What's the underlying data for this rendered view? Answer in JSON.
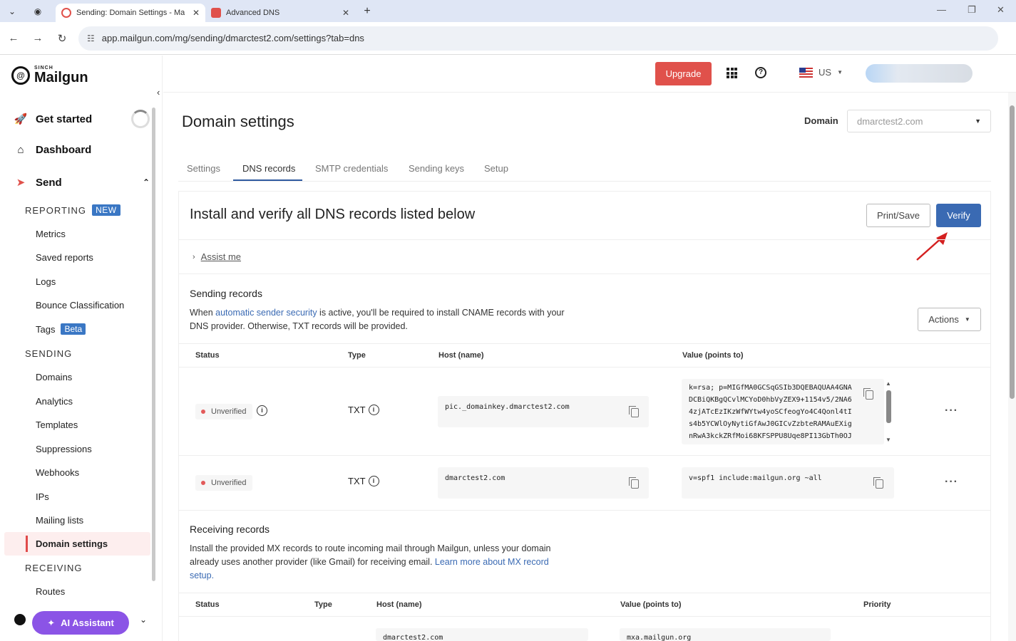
{
  "browser": {
    "tabs": [
      {
        "title": "Sending: Domain Settings - Ma",
        "active": true
      },
      {
        "title": "Advanced DNS",
        "active": false
      }
    ],
    "new_tab": "+",
    "url": "app.mailgun.com/mg/sending/dmarctest2.com/settings?tab=dns"
  },
  "brand": {
    "sinch": "SINCH",
    "name": "Mailgun"
  },
  "sidebar": {
    "get_started": "Get started",
    "dashboard": "Dashboard",
    "send": "Send",
    "reporting": {
      "label": "REPORTING",
      "badge": "NEW"
    },
    "reporting_items": [
      "Metrics",
      "Saved reports",
      "Logs",
      "Bounce Classification",
      "Tags"
    ],
    "tags_badge": "Beta",
    "sending": {
      "label": "SENDING"
    },
    "sending_items": [
      "Domains",
      "Analytics",
      "Templates",
      "Suppressions",
      "Webhooks",
      "IPs",
      "Mailing lists",
      "Domain settings"
    ],
    "receiving": {
      "label": "RECEIVING"
    },
    "receiving_items": [
      "Routes"
    ],
    "ai_assistant": "AI Assistant"
  },
  "header": {
    "upgrade": "Upgrade",
    "region": "US"
  },
  "page": {
    "title": "Domain settings",
    "domain_label": "Domain",
    "domain_value": "dmarctest2.com",
    "tabs": [
      "Settings",
      "DNS records",
      "SMTP credentials",
      "Sending keys",
      "Setup"
    ],
    "active_tab": "DNS records"
  },
  "card": {
    "heading": "Install and verify all DNS records listed below",
    "print_save": "Print/Save",
    "verify": "Verify",
    "assist_me": "Assist me"
  },
  "sending_records": {
    "title": "Sending records",
    "desc_pre": "When ",
    "desc_link": "automatic sender security",
    "desc_post": " is active, you'll be required to install CNAME records with your",
    "desc_line2": "DNS provider. Otherwise, TXT records will be provided.",
    "actions": "Actions",
    "columns": [
      "Status",
      "Type",
      "Host (name)",
      "Value (points to)"
    ],
    "rows": [
      {
        "status": "Unverified",
        "type": "TXT",
        "host": "pic._domainkey.dmarctest2.com",
        "value_lines": [
          "k=rsa; p=MIGfMA0GCSqGSIb3DQEBAQUAA4GNA",
          "DCBiQKBgQCvlMCYoD0hbVyZEX9+1154v5/2NA6",
          "4zjATcEzIKzWfWYtw4yoSCfeogYo4C4Qonl4tI",
          "s4b5YCWlOyNytiGfAwJ0GICvZzbteRAMAuEXig",
          "nRwA3kckZRfMoi68KFSPPU8Uqe8PI13GbTh0OJ"
        ]
      },
      {
        "status": "Unverified",
        "type": "TXT",
        "host": "dmarctest2.com",
        "value_lines": [
          "v=spf1 include:mailgun.org ~all"
        ]
      }
    ]
  },
  "receiving_records": {
    "title": "Receiving records",
    "desc_line1": "Install the provided MX records to route incoming mail through Mailgun, unless your domain",
    "desc_line2_pre": "already uses another provider (like Gmail) for receiving email. ",
    "desc_link": "Learn more about MX record",
    "desc_line3_link": "setup.",
    "columns": [
      "Status",
      "Type",
      "Host (name)",
      "Value (points to)",
      "Priority"
    ],
    "rows": [
      {
        "host": "dmarctest2.com",
        "value": "mxa.mailgun.org"
      }
    ]
  },
  "colors": {
    "accent": "#3a6ab3",
    "upgrade": "#e0514b",
    "ai": "#8b54e6",
    "unverified": "#e25a5a"
  }
}
